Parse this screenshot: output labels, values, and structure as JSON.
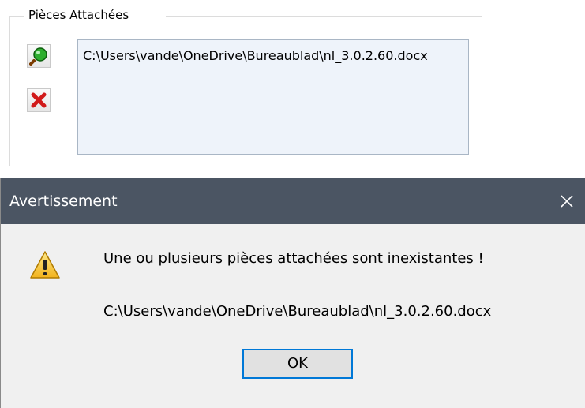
{
  "attachments": {
    "group_title": "Pièces Attachées",
    "items": [
      {
        "path": "C:\\Users\\vande\\OneDrive\\Bureaublad\\nl_3.0.2.60.docx"
      }
    ],
    "icons": {
      "open": "magnifier-icon",
      "delete": "red-x-delete-icon"
    }
  },
  "dialog": {
    "title": "Avertissement",
    "close_glyph": "✕",
    "message": "Une ou plusieurs pièces attachées sont inexistantes !",
    "path": "C:\\Users\\vande\\OneDrive\\Bureaublad\\nl_3.0.2.60.docx",
    "ok_label": "OK",
    "icon": "warning-icon"
  },
  "colors": {
    "titlebar": "#4b5563",
    "listbox_bg": "#eef3fa",
    "dialog_bg": "#f0f0f0",
    "ok_border": "#0078d7",
    "delete_red": "#d11a1a",
    "warning_yellow": "#f2c230"
  }
}
